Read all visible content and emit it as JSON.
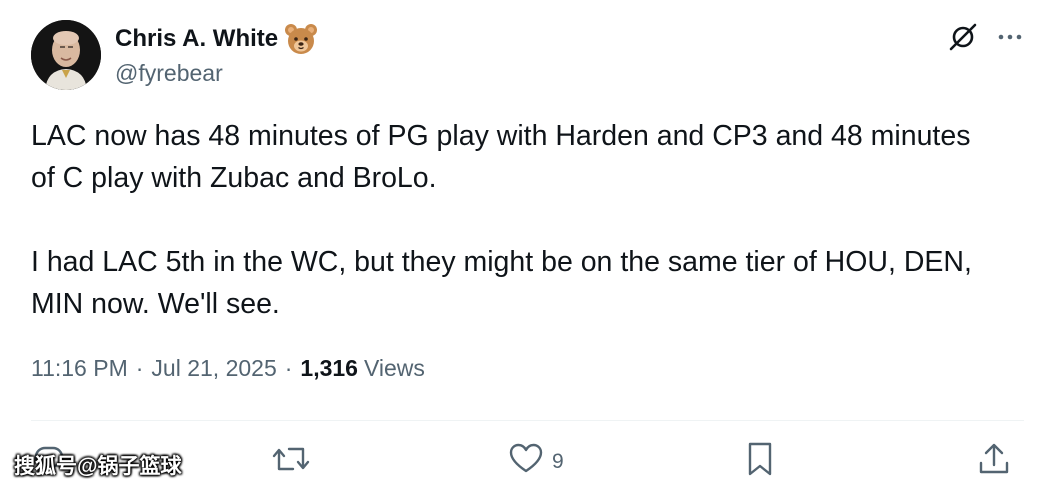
{
  "author": {
    "display_name": "Chris A. White",
    "name_emoji": "bear-face-icon",
    "handle": "@fyrebear"
  },
  "top_actions": {
    "grok_icon": "grok-icon",
    "more_icon": "more-icon"
  },
  "tweet": {
    "text": "LAC now has 48 minutes of PG play with Harden and CP3 and 48 minutes of C play with Zubac and BroLo.\n\nI had LAC 5th in the WC, but they might be on the same tier of HOU, DEN, MIN now. We'll see.",
    "time": "11:16 PM",
    "separator": "·",
    "date": "Jul 21, 2025",
    "views_count": "1,316",
    "views_label": "Views"
  },
  "actions": {
    "reply_icon": "reply-icon",
    "retweet_icon": "retweet-icon",
    "like_icon": "like-icon",
    "like_count": "9",
    "bookmark_icon": "bookmark-icon",
    "share_icon": "share-icon"
  },
  "watermark": "搜狐号@锅子篮球",
  "colors": {
    "text_primary": "#0f1419",
    "text_secondary": "#536471",
    "divider": "#eff3f4"
  }
}
